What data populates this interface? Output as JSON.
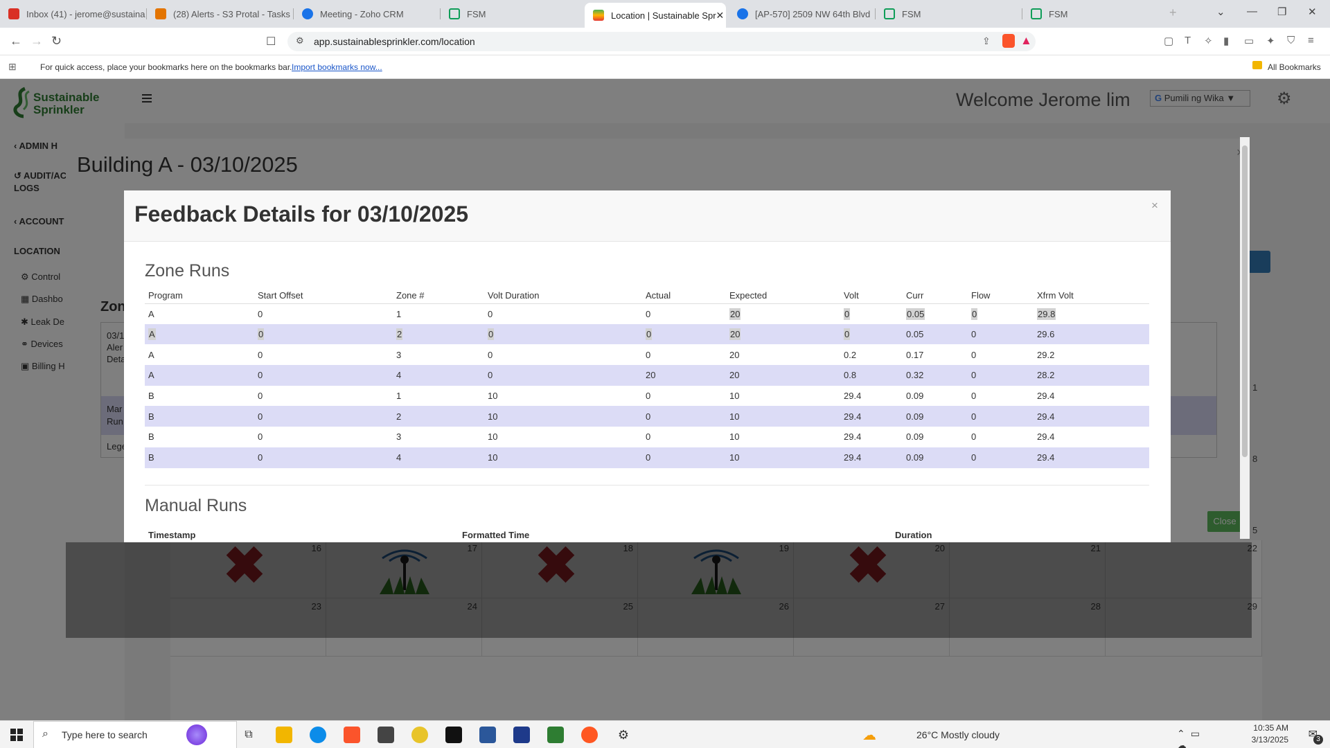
{
  "browser": {
    "tabs": [
      {
        "label": "Inbox (41) - jerome@sustaina",
        "icon": "gmail-icon",
        "color": "#d93025"
      },
      {
        "label": "(28) Alerts - S3 Protal - Tasks",
        "icon": "tasks-icon",
        "color": "#e37400"
      },
      {
        "label": "Meeting - Zoho CRM",
        "icon": "zoho-icon",
        "color": "#1a73e8"
      },
      {
        "label": "FSM",
        "icon": "fsm-icon",
        "color": "#0f9d58"
      },
      {
        "label": "Location | Sustainable Spr",
        "icon": "sustainable-icon",
        "color": "#4caf50"
      },
      {
        "label": "[AP-570] 2509 NW 64th Blvd",
        "icon": "jira-icon",
        "color": "#1a73e8"
      },
      {
        "label": "FSM",
        "icon": "fsm-icon",
        "color": "#0f9d58"
      },
      {
        "label": "FSM",
        "icon": "fsm-icon",
        "color": "#0f9d58"
      }
    ],
    "active_tab": 4,
    "url": "app.sustainablesprinkler.com/location",
    "bookmarks_msg": "For quick access, place your bookmarks here on the bookmarks bar.",
    "bookmarks_link": "Import bookmarks now...",
    "all_bookmarks": "All Bookmarks"
  },
  "app": {
    "logo_line1": "Sustainable",
    "logo_line2": "Sprinkler",
    "welcome": "Welcome Jerome lim",
    "language": "Pumili ng Wika",
    "sidebar": {
      "items": [
        "ADMIN H",
        "AUDIT/AC",
        "LOGS",
        "ACCOUNT",
        "LOCATION"
      ],
      "subitems": [
        "Control",
        "Dashbo",
        "Leak De",
        "Devices",
        "Billing H"
      ]
    },
    "bg_zone_label": "Zon",
    "bg_zone_rows": [
      "03/1",
      "Aler",
      "Deta",
      "Mar",
      "Run",
      "Lege"
    ],
    "calendar": {
      "week1": [
        "16",
        "17",
        "18",
        "19",
        "20",
        "21",
        "22"
      ],
      "week2": [
        "23",
        "24",
        "25",
        "26",
        "27",
        "28",
        "29"
      ],
      "side_numbers": [
        "1",
        "8",
        "5"
      ]
    }
  },
  "modal_bg": {
    "title": "Building A - 03/10/2025",
    "close_label": "Close",
    "close_x": "×"
  },
  "modal": {
    "title": "Feedback Details for 03/10/2025",
    "close_x": "×",
    "zone_runs": {
      "title": "Zone Runs",
      "columns": [
        "Program",
        "Start Offset",
        "Zone #",
        "Volt Duration",
        "Actual",
        "Expected",
        "Volt",
        "Curr",
        "Flow",
        "Xfrm Volt"
      ],
      "rows": [
        [
          "A",
          "0",
          "1",
          "0",
          "0",
          "20",
          "0",
          "0.05",
          "0",
          "29.8"
        ],
        [
          "A",
          "0",
          "2",
          "0",
          "0",
          "20",
          "0",
          "0.05",
          "0",
          "29.6"
        ],
        [
          "A",
          "0",
          "3",
          "0",
          "0",
          "20",
          "0.2",
          "0.17",
          "0",
          "29.2"
        ],
        [
          "A",
          "0",
          "4",
          "0",
          "20",
          "20",
          "0.8",
          "0.32",
          "0",
          "28.2"
        ],
        [
          "B",
          "0",
          "1",
          "10",
          "0",
          "10",
          "29.4",
          "0.09",
          "0",
          "29.4"
        ],
        [
          "B",
          "0",
          "2",
          "10",
          "0",
          "10",
          "29.4",
          "0.09",
          "0",
          "29.4"
        ],
        [
          "B",
          "0",
          "3",
          "10",
          "0",
          "10",
          "29.4",
          "0.09",
          "0",
          "29.4"
        ],
        [
          "B",
          "0",
          "4",
          "10",
          "0",
          "10",
          "29.4",
          "0.09",
          "0",
          "29.4"
        ]
      ]
    },
    "manual_runs": {
      "title": "Manual Runs",
      "columns": [
        "Timestamp",
        "Formatted Time",
        "Duration"
      ]
    }
  },
  "taskbar": {
    "search_placeholder": "Type here to search",
    "weather": "26°C  Mostly cloudy",
    "time": "10:35 AM",
    "date": "3/13/2025",
    "notifications": "3"
  }
}
